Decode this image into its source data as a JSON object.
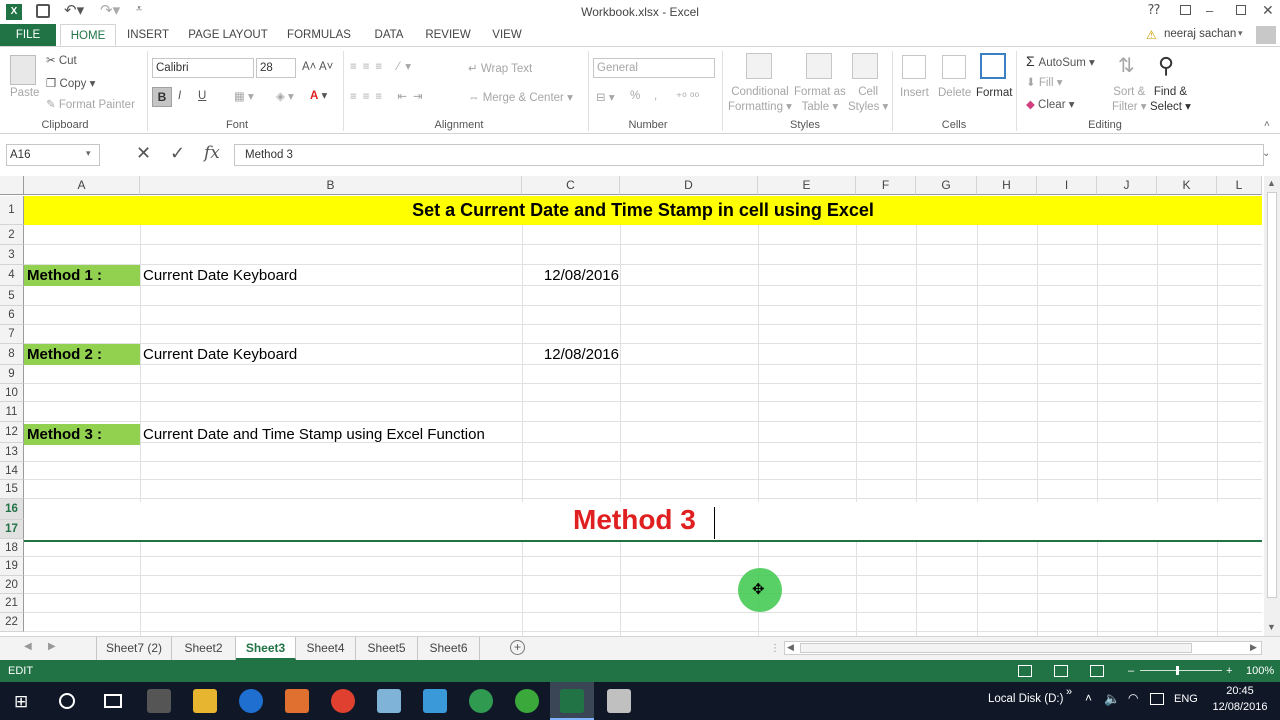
{
  "window": {
    "title": "Workbook.xlsx - Excel",
    "user": "neeraj sachan"
  },
  "tabs": [
    "FILE",
    "HOME",
    "INSERT",
    "PAGE LAYOUT",
    "FORMULAS",
    "DATA",
    "REVIEW",
    "VIEW"
  ],
  "ribbon": {
    "clipboard": {
      "paste": "Paste",
      "cut": "Cut",
      "copy": "Copy",
      "format_painter": "Format Painter",
      "label": "Clipboard"
    },
    "font": {
      "name": "Calibri",
      "size": "28",
      "label": "Font",
      "bold": "B",
      "italic": "I",
      "underline": "U"
    },
    "alignment": {
      "wrap": "Wrap Text",
      "merge": "Merge & Center",
      "label": "Alignment"
    },
    "number": {
      "format": "General",
      "percent": "%",
      "comma": ",",
      "label": "Number"
    },
    "styles": {
      "conditional": "Conditional",
      "conditional2": "Formatting",
      "format_as": "Format as",
      "format_as2": "Table",
      "cell": "Cell",
      "cell2": "Styles",
      "label": "Styles"
    },
    "cells": {
      "insert": "Insert",
      "delete": "Delete",
      "format": "Format",
      "label": "Cells"
    },
    "editing": {
      "autosum": "AutoSum",
      "fill": "Fill",
      "clear": "Clear",
      "sort": "Sort &",
      "sort2": "Filter",
      "find": "Find &",
      "find2": "Select",
      "label": "Editing"
    }
  },
  "formula_bar": {
    "name_box": "A16",
    "content": "Method 3",
    "fx": "fx"
  },
  "columns": [
    "A",
    "B",
    "C",
    "D",
    "E",
    "F",
    "G",
    "H",
    "I",
    "J",
    "K",
    "L"
  ],
  "rows": [
    "1",
    "2",
    "3",
    "4",
    "5",
    "6",
    "7",
    "8",
    "9",
    "10",
    "11",
    "12",
    "13",
    "14",
    "15",
    "16",
    "17",
    "18",
    "19",
    "20",
    "21",
    "22"
  ],
  "cells": {
    "title": "Set a Current Date and Time Stamp in cell using Excel",
    "m1_label": "Method 1 :",
    "m1_desc": "Current Date Keyboard",
    "m1_date": "12/08/2016",
    "m2_label": "Method 2 :",
    "m2_desc": "Current Date Keyboard",
    "m2_date": "12/08/2016",
    "m3_label": "Method 3 :",
    "m3_desc": "Current Date and Time Stamp using Excel Function",
    "editing": "Method 3"
  },
  "sheets": [
    "Sheet7 (2)",
    "Sheet2",
    "Sheet3",
    "Sheet4",
    "Sheet5",
    "Sheet6"
  ],
  "active_sheet": "Sheet3",
  "status": {
    "mode": "EDIT",
    "zoom": "100%"
  },
  "taskbar": {
    "disk": "Local Disk (D:)",
    "lang": "ENG",
    "time": "20:45",
    "date": "12/08/2016"
  },
  "colors": {
    "accent": "#217346",
    "title_fill": "#ffff00",
    "label_fill": "#92d050",
    "method_text": "#e02020"
  }
}
